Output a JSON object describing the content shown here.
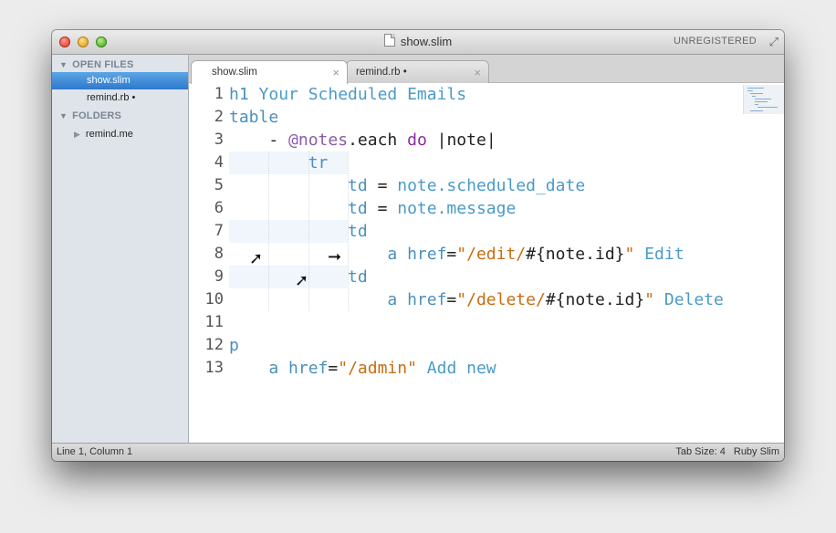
{
  "window": {
    "title": "show.slim",
    "badge": "UNREGISTERED",
    "fullscreen_icon": "fullscreen-arrows-icon"
  },
  "sidebar": {
    "open_files_header": "OPEN FILES",
    "open_files": [
      {
        "label": "show.slim",
        "selected": true
      },
      {
        "label": "remind.rb •",
        "selected": false
      }
    ],
    "folders_header": "FOLDERS",
    "folders": [
      {
        "label": "remind.me"
      }
    ]
  },
  "tabs": [
    {
      "label": "show.slim",
      "active": true,
      "close": "×"
    },
    {
      "label": "remind.rb •",
      "active": false,
      "close": "×"
    }
  ],
  "editor": {
    "line_numbers": [
      "1",
      "2",
      "3",
      "4",
      "5",
      "6",
      "7",
      "8",
      "9",
      "10",
      "11",
      "12",
      "13"
    ],
    "lines": [
      {
        "indent": "",
        "parts": [
          [
            "kw",
            "h1"
          ],
          [
            "txt",
            " Your Scheduled Emails"
          ]
        ]
      },
      {
        "indent": "",
        "parts": [
          [
            "kw",
            "table"
          ]
        ]
      },
      {
        "indent": "    ",
        "parts": [
          [
            "plain",
            "- "
          ],
          [
            "ivar",
            "@notes"
          ],
          [
            "plain",
            ".each "
          ],
          [
            "doKw",
            "do"
          ],
          [
            "plain",
            " |note|"
          ]
        ]
      },
      {
        "indent": "        ",
        "parts": [
          [
            "kw",
            "tr"
          ]
        ]
      },
      {
        "indent": "            ",
        "parts": [
          [
            "kw",
            "td"
          ],
          [
            "plain",
            " = "
          ],
          [
            "txt",
            "note.scheduled_date"
          ]
        ]
      },
      {
        "indent": "            ",
        "parts": [
          [
            "kw",
            "td"
          ],
          [
            "plain",
            " = "
          ],
          [
            "txt",
            "note.message"
          ]
        ]
      },
      {
        "indent": "            ",
        "parts": [
          [
            "kw",
            "td"
          ]
        ]
      },
      {
        "indent": "                ",
        "parts": [
          [
            "kw",
            "a href"
          ],
          [
            "plain",
            "="
          ],
          [
            "str",
            "\"/edit/"
          ],
          [
            "plain",
            "#{note.id}"
          ],
          [
            "str",
            "\""
          ],
          [
            "txt",
            " Edit"
          ]
        ]
      },
      {
        "indent": "            ",
        "parts": [
          [
            "kw",
            "td"
          ]
        ]
      },
      {
        "indent": "                ",
        "parts": [
          [
            "kw",
            "a href"
          ],
          [
            "plain",
            "="
          ],
          [
            "str",
            "\"/delete/"
          ],
          [
            "plain",
            "#{note.id}"
          ],
          [
            "str",
            "\""
          ],
          [
            "txt",
            " Delete"
          ]
        ]
      },
      {
        "indent": "",
        "parts": []
      },
      {
        "indent": "",
        "parts": [
          [
            "kw",
            "p"
          ]
        ]
      },
      {
        "indent": "    ",
        "parts": [
          [
            "kw",
            "a href"
          ],
          [
            "plain",
            "="
          ],
          [
            "str",
            "\"/admin\""
          ],
          [
            "txt",
            " Add new"
          ]
        ]
      }
    ]
  },
  "status": {
    "position": "Line 1, Column 1",
    "tab_size": "Tab Size: 4",
    "syntax": "Ruby Slim"
  }
}
